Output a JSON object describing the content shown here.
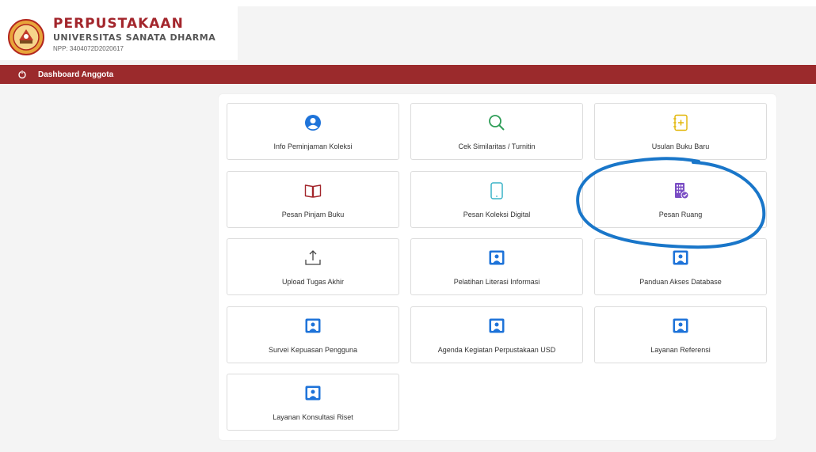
{
  "header": {
    "title": "PERPUSTAKAAN",
    "subtitle": "UNIVERSITAS SANATA DHARMA",
    "npp": "NPP: 3404072D2020617",
    "logo_icon": "university-seal"
  },
  "nav": {
    "home_icon": "home-icon",
    "item_label": "Dashboard Anggota",
    "bar_color": "#9b2a2c"
  },
  "menu": [
    {
      "label": "Info Peminjaman Koleksi",
      "icon": "user-circle-icon",
      "color": "#1e73d9"
    },
    {
      "label": "Cek Similaritas / Turnitin",
      "icon": "search-icon",
      "color": "#2e9d57"
    },
    {
      "label": "Usulan Buku Baru",
      "icon": "notebook-plus-icon",
      "color": "#e1b400"
    },
    {
      "label": "Pesan Pinjam Buku",
      "icon": "book-open-icon",
      "color": "#a3262c"
    },
    {
      "label": "Pesan Koleksi Digital",
      "icon": "tablet-icon",
      "color": "#3ab3c7"
    },
    {
      "label": "Pesan Ruang",
      "icon": "building-check-icon",
      "color": "#7a4dc4"
    },
    {
      "label": "Upload Tugas Akhir",
      "icon": "upload-icon",
      "color": "#444444"
    },
    {
      "label": "Pelatihan Literasi Informasi",
      "icon": "person-board-icon",
      "color": "#1e73d9"
    },
    {
      "label": "Panduan Akses Database",
      "icon": "person-board-icon",
      "color": "#1e73d9"
    },
    {
      "label": "Survei Kepuasan Pengguna",
      "icon": "person-board-icon",
      "color": "#1e73d9"
    },
    {
      "label": "Agenda Kegiatan Perpustakaan USD",
      "icon": "person-board-icon",
      "color": "#1e73d9"
    },
    {
      "label": "Layanan Referensi",
      "icon": "person-board-icon",
      "color": "#1e73d9"
    },
    {
      "label": "Layanan Konsultasi Riset",
      "icon": "person-board-icon",
      "color": "#1e73d9"
    }
  ],
  "annotation": {
    "color": "#1976c9",
    "note": "hand-drawn circle around Pesan Ruang"
  }
}
